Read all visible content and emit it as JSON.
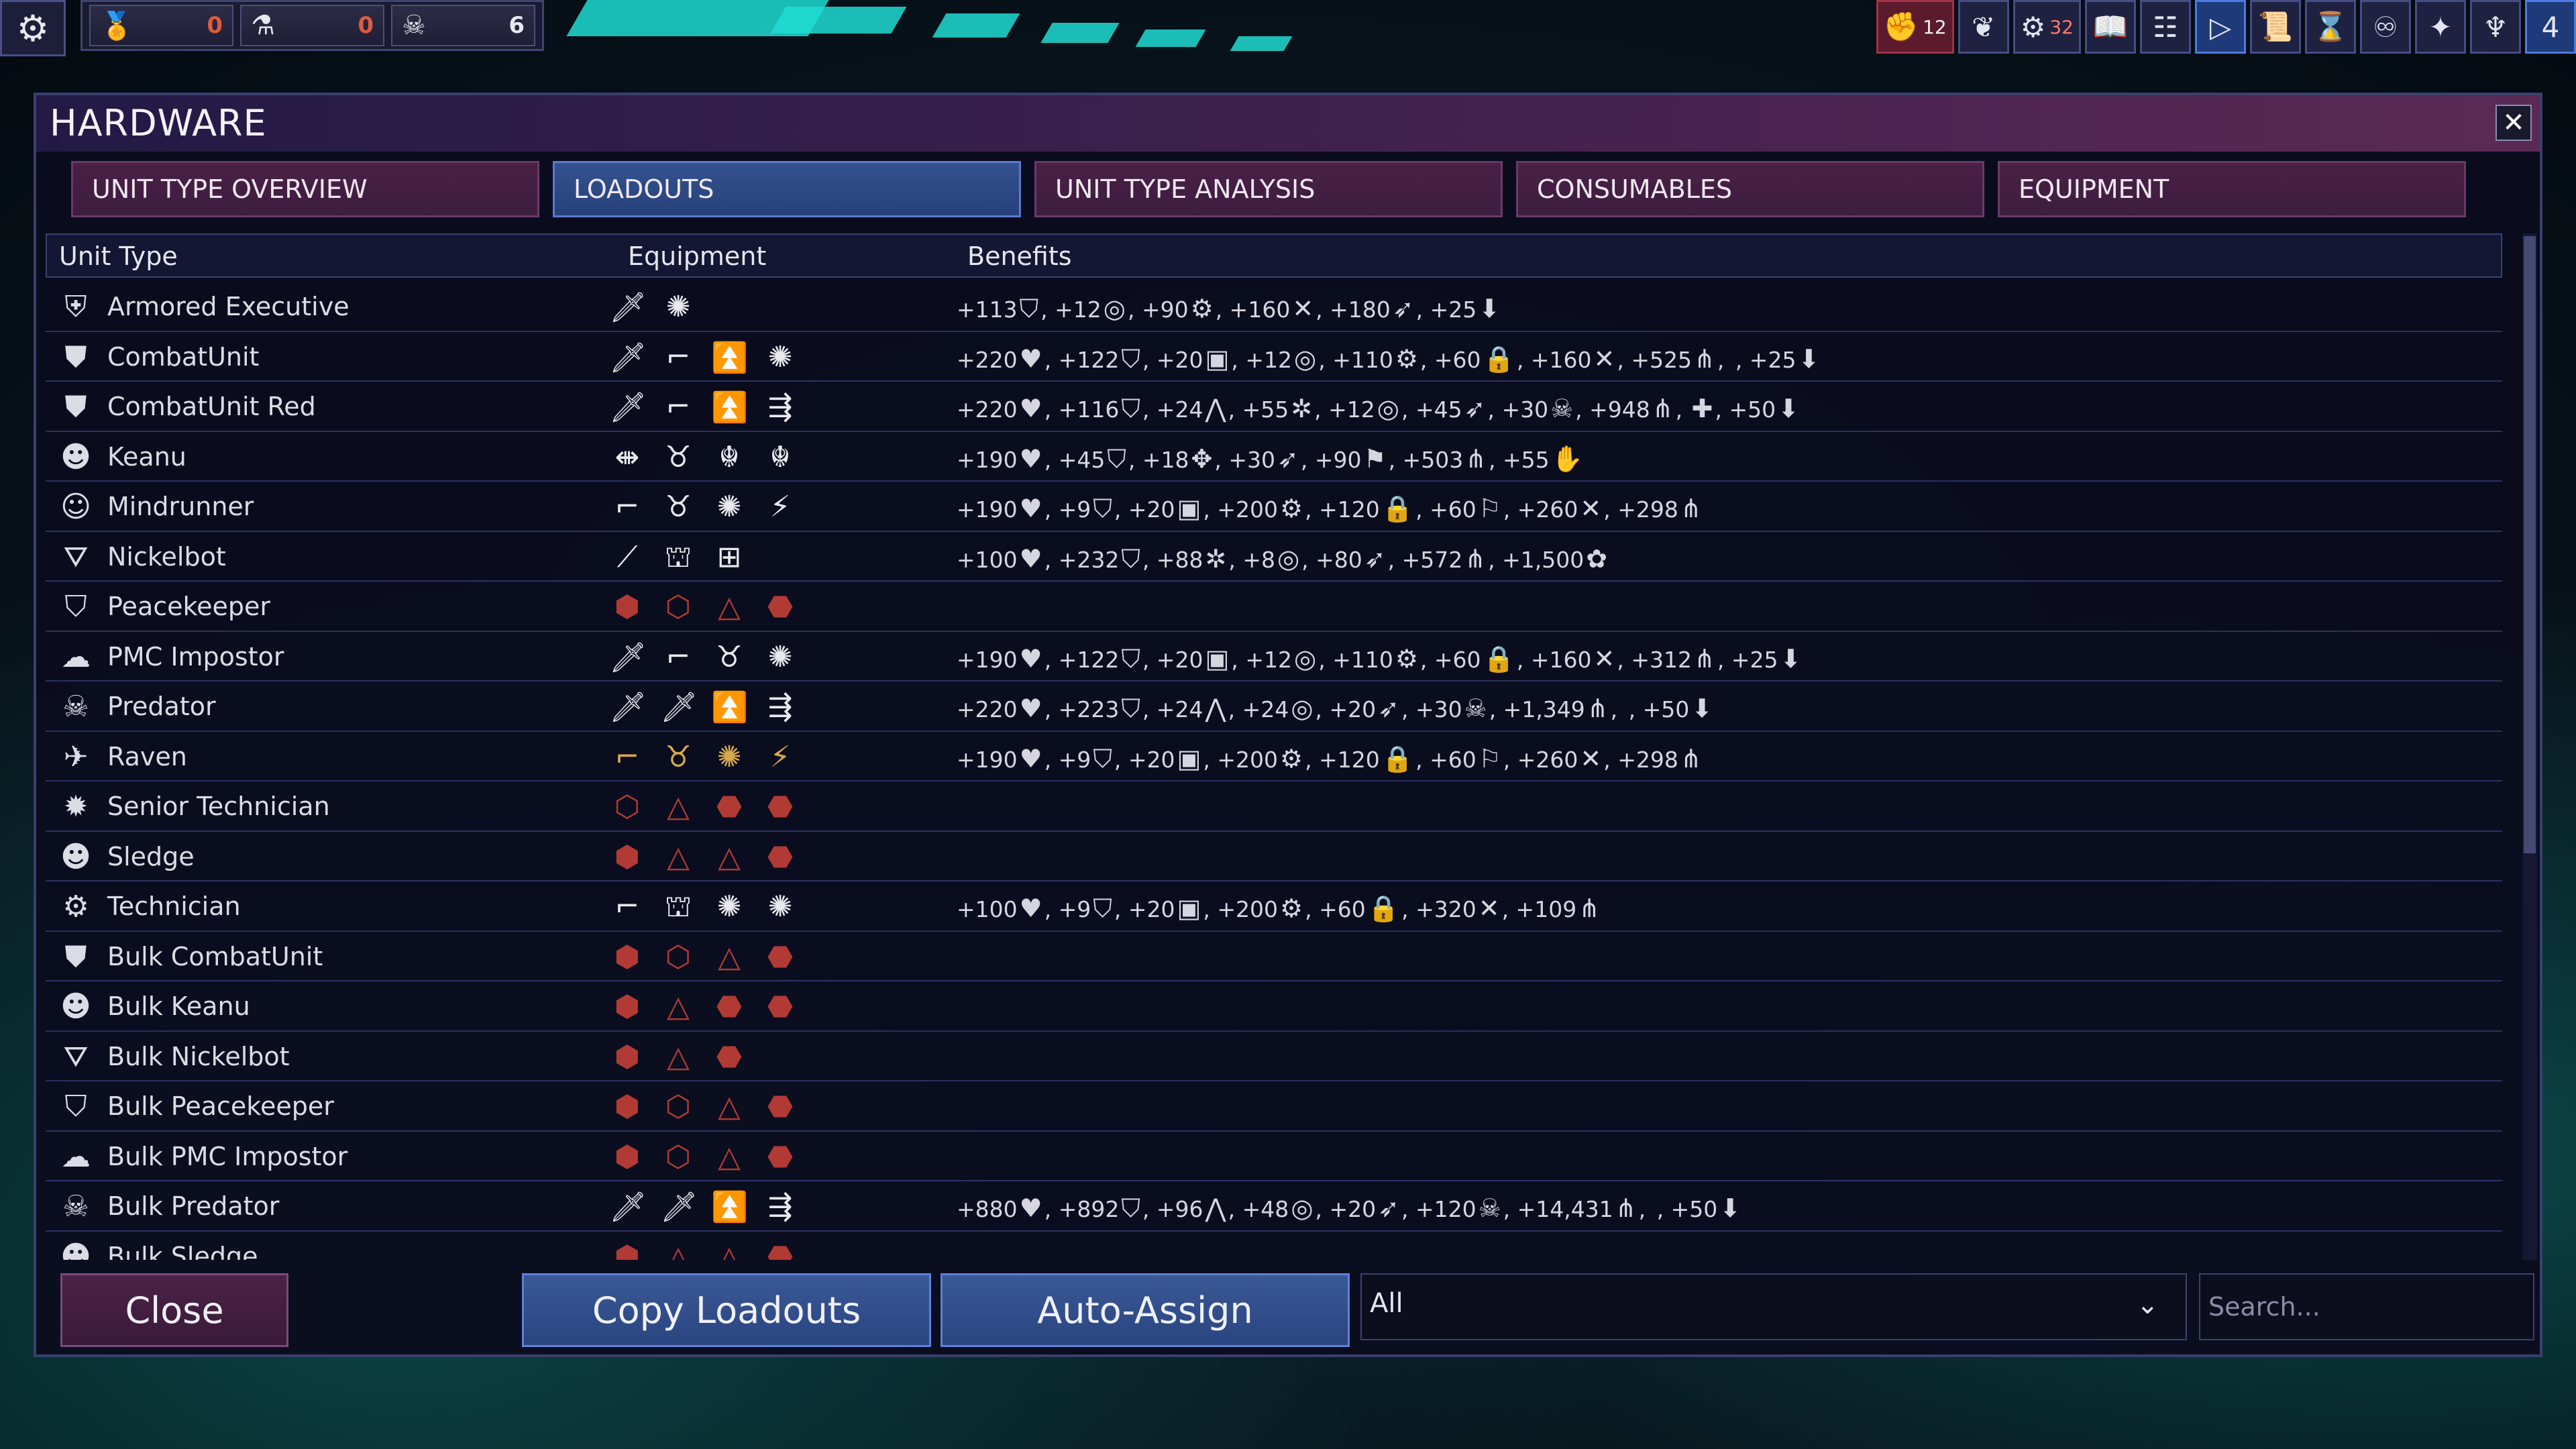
{
  "hud": {
    "resources": [
      {
        "icon": "medal-icon",
        "glyph": "🏅",
        "value": "0"
      },
      {
        "icon": "flask-icon",
        "glyph": "⚗",
        "value": "0"
      },
      {
        "icon": "skull-icon",
        "glyph": "☠",
        "value": "6"
      }
    ],
    "toolbar": [
      {
        "icon": "fist-icon",
        "glyph": "✊",
        "badge": "12",
        "style": "red"
      },
      {
        "icon": "laurel-icon",
        "glyph": "❦"
      },
      {
        "icon": "gear-alert-icon",
        "glyph": "⚙",
        "badge": "32",
        "badge_style": "red"
      },
      {
        "icon": "book-icon",
        "glyph": "📖"
      },
      {
        "icon": "levels-icon",
        "glyph": "☷"
      },
      {
        "icon": "play-icon",
        "glyph": "▷",
        "style": "blue"
      },
      {
        "icon": "scroll-icon",
        "glyph": "📜"
      },
      {
        "icon": "hourglass-icon",
        "glyph": "⌛"
      },
      {
        "icon": "brain-icon",
        "glyph": "♾"
      },
      {
        "icon": "emblem-icon",
        "glyph": "✦"
      },
      {
        "icon": "trident-icon",
        "glyph": "♆"
      },
      {
        "icon": "number-icon",
        "glyph": "4",
        "style": "blue"
      }
    ]
  },
  "window": {
    "title": "HARDWARE",
    "tabs": [
      "UNIT TYPE OVERVIEW",
      "LOADOUTS",
      "UNIT TYPE ANALYSIS",
      "CONSUMABLES",
      "EQUIPMENT"
    ],
    "active_tab": 1,
    "columns": [
      "Unit Type",
      "Equipment",
      "Benefits"
    ]
  },
  "rows": [
    {
      "name": "Armored Executive",
      "icon": "⛨",
      "equip": [
        {
          "g": "🗡"
        },
        {
          "g": "✺"
        }
      ],
      "benefits": [
        [
          "+113",
          "⛉"
        ],
        [
          "+12",
          "◎"
        ],
        [
          "+90",
          "⚙"
        ],
        [
          "+160",
          "✕"
        ],
        [
          "+180",
          "➶"
        ],
        [
          "+25",
          "⬇"
        ]
      ]
    },
    {
      "name": "CombatUnit",
      "icon": "⛊",
      "equip": [
        {
          "g": "🗡"
        },
        {
          "g": "⌐"
        },
        {
          "g": "⏫"
        },
        {
          "g": "✺"
        }
      ],
      "benefits": [
        [
          "+220",
          "♥"
        ],
        [
          "+122",
          "⛉"
        ],
        [
          "+20",
          "▣"
        ],
        [
          "+12",
          "◎"
        ],
        [
          "+110",
          "⚙"
        ],
        [
          "+60",
          "🔒"
        ],
        [
          "+160",
          "✕"
        ],
        [
          "+525",
          "⋔"
        ],
        [
          "",
          ""
        ],
        [
          "+25",
          "⬇"
        ]
      ]
    },
    {
      "name": "CombatUnit Red",
      "icon": "⛊",
      "equip": [
        {
          "g": "🗡"
        },
        {
          "g": "⌐"
        },
        {
          "g": "⏫"
        },
        {
          "g": "⇶"
        }
      ],
      "benefits": [
        [
          "+220",
          "♥"
        ],
        [
          "+116",
          "⛉"
        ],
        [
          "+24",
          "⋀"
        ],
        [
          "+55",
          "✲"
        ],
        [
          "+12",
          "◎"
        ],
        [
          "+45",
          "➶"
        ],
        [
          "+30",
          "☠"
        ],
        [
          "+948",
          "⋔"
        ],
        [
          "",
          "✚"
        ],
        [
          "+50",
          "⬇"
        ]
      ]
    },
    {
      "name": "Keanu",
      "icon": "☻",
      "equip": [
        {
          "g": "⇼"
        },
        {
          "g": "♉"
        },
        {
          "g": "☬"
        },
        {
          "g": "☬"
        }
      ],
      "benefits": [
        [
          "+190",
          "♥"
        ],
        [
          "+45",
          "⛉"
        ],
        [
          "+18",
          "✥"
        ],
        [
          "+30",
          "➶"
        ],
        [
          "+90",
          "⚑"
        ],
        [
          "+503",
          "⋔"
        ],
        [
          "+55",
          "✋"
        ]
      ]
    },
    {
      "name": "Mindrunner",
      "icon": "☺",
      "equip": [
        {
          "g": "⌐"
        },
        {
          "g": "♉"
        },
        {
          "g": "✺"
        },
        {
          "g": "⚡"
        }
      ],
      "benefits": [
        [
          "+190",
          "♥"
        ],
        [
          "+9",
          "⛉"
        ],
        [
          "+20",
          "▣"
        ],
        [
          "+200",
          "⚙"
        ],
        [
          "+120",
          "🔒"
        ],
        [
          "+60",
          "⚐"
        ],
        [
          "+260",
          "✕"
        ],
        [
          "+298",
          "⋔"
        ]
      ]
    },
    {
      "name": "Nickelbot",
      "icon": "⛛",
      "equip": [
        {
          "g": "⟋"
        },
        {
          "g": "⛫"
        },
        {
          "g": "⊞"
        }
      ],
      "benefits": [
        [
          "+100",
          "♥"
        ],
        [
          "+232",
          "⛉"
        ],
        [
          "+88",
          "✲"
        ],
        [
          "+8",
          "◎"
        ],
        [
          "+80",
          "➶"
        ],
        [
          "+572",
          "⋔"
        ],
        [
          "+1,500",
          "✿"
        ]
      ]
    },
    {
      "name": "Peacekeeper",
      "icon": "⛉",
      "equip": [
        {
          "g": "⬢",
          "m": 1
        },
        {
          "g": "⬡",
          "m": 1
        },
        {
          "g": "△",
          "m": 1
        },
        {
          "g": "⬣",
          "m": 1
        }
      ],
      "benefits": []
    },
    {
      "name": "PMC Impostor",
      "icon": "☁",
      "equip": [
        {
          "g": "🗡"
        },
        {
          "g": "⌐"
        },
        {
          "g": "♉"
        },
        {
          "g": "✺"
        }
      ],
      "benefits": [
        [
          "+190",
          "♥"
        ],
        [
          "+122",
          "⛉"
        ],
        [
          "+20",
          "▣"
        ],
        [
          "+12",
          "◎"
        ],
        [
          "+110",
          "⚙"
        ],
        [
          "+60",
          "🔒"
        ],
        [
          "+160",
          "✕"
        ],
        [
          "+312",
          "⋔"
        ],
        [
          "+25",
          "⬇"
        ]
      ]
    },
    {
      "name": "Predator",
      "icon": "☠",
      "equip": [
        {
          "g": "🗡"
        },
        {
          "g": "🗡"
        },
        {
          "g": "⏫"
        },
        {
          "g": "⇶"
        }
      ],
      "benefits": [
        [
          "+220",
          "♥"
        ],
        [
          "+223",
          "⛉"
        ],
        [
          "+24",
          "⋀"
        ],
        [
          "+24",
          "◎"
        ],
        [
          "+20",
          "➶"
        ],
        [
          "+30",
          "☠"
        ],
        [
          "+1,349",
          "⋔"
        ],
        [
          "",
          ""
        ],
        [
          "+50",
          "⬇"
        ]
      ]
    },
    {
      "name": "Raven",
      "icon": "✈",
      "equip": [
        {
          "g": "⌐",
          "gold": 1
        },
        {
          "g": "♉",
          "gold": 1
        },
        {
          "g": "✺",
          "gold": 1
        },
        {
          "g": "⚡",
          "gold": 1
        }
      ],
      "benefits": [
        [
          "+190",
          "♥"
        ],
        [
          "+9",
          "⛉"
        ],
        [
          "+20",
          "▣"
        ],
        [
          "+200",
          "⚙"
        ],
        [
          "+120",
          "🔒"
        ],
        [
          "+60",
          "⚐"
        ],
        [
          "+260",
          "✕"
        ],
        [
          "+298",
          "⋔"
        ]
      ]
    },
    {
      "name": "Senior Technician",
      "icon": "✹",
      "equip": [
        {
          "g": "⬡",
          "m": 1
        },
        {
          "g": "△",
          "m": 1
        },
        {
          "g": "⬣",
          "m": 1
        },
        {
          "g": "⬣",
          "m": 1
        }
      ],
      "benefits": []
    },
    {
      "name": "Sledge",
      "icon": "☻",
      "equip": [
        {
          "g": "⬢",
          "m": 1
        },
        {
          "g": "△",
          "m": 1
        },
        {
          "g": "△",
          "m": 1
        },
        {
          "g": "⬣",
          "m": 1
        }
      ],
      "benefits": []
    },
    {
      "name": "Technician",
      "icon": "⚙",
      "equip": [
        {
          "g": "⌐"
        },
        {
          "g": "⛫"
        },
        {
          "g": "✺"
        },
        {
          "g": "✺"
        }
      ],
      "benefits": [
        [
          "+100",
          "♥"
        ],
        [
          "+9",
          "⛉"
        ],
        [
          "+20",
          "▣"
        ],
        [
          "+200",
          "⚙"
        ],
        [
          "+60",
          "🔒"
        ],
        [
          "+320",
          "✕"
        ],
        [
          "+109",
          "⋔"
        ]
      ]
    },
    {
      "name": "Bulk CombatUnit",
      "icon": "⛊",
      "equip": [
        {
          "g": "⬢",
          "m": 1
        },
        {
          "g": "⬡",
          "m": 1
        },
        {
          "g": "△",
          "m": 1
        },
        {
          "g": "⬣",
          "m": 1
        }
      ],
      "benefits": []
    },
    {
      "name": "Bulk Keanu",
      "icon": "☻",
      "equip": [
        {
          "g": "⬢",
          "m": 1
        },
        {
          "g": "△",
          "m": 1
        },
        {
          "g": "⬣",
          "m": 1
        },
        {
          "g": "⬣",
          "m": 1
        }
      ],
      "benefits": []
    },
    {
      "name": "Bulk Nickelbot",
      "icon": "⛛",
      "equip": [
        {
          "g": "⬢",
          "m": 1
        },
        {
          "g": "△",
          "m": 1
        },
        {
          "g": "⬣",
          "m": 1
        }
      ],
      "benefits": []
    },
    {
      "name": "Bulk Peacekeeper",
      "icon": "⛉",
      "equip": [
        {
          "g": "⬢",
          "m": 1
        },
        {
          "g": "⬡",
          "m": 1
        },
        {
          "g": "△",
          "m": 1
        },
        {
          "g": "⬣",
          "m": 1
        }
      ],
      "benefits": []
    },
    {
      "name": "Bulk PMC Impostor",
      "icon": "☁",
      "equip": [
        {
          "g": "⬢",
          "m": 1
        },
        {
          "g": "⬡",
          "m": 1
        },
        {
          "g": "△",
          "m": 1
        },
        {
          "g": "⬣",
          "m": 1
        }
      ],
      "benefits": []
    },
    {
      "name": "Bulk Predator",
      "icon": "☠",
      "equip": [
        {
          "g": "🗡"
        },
        {
          "g": "🗡"
        },
        {
          "g": "⏫"
        },
        {
          "g": "⇶"
        }
      ],
      "benefits": [
        [
          "+880",
          "♥"
        ],
        [
          "+892",
          "⛉"
        ],
        [
          "+96",
          "⋀"
        ],
        [
          "+48",
          "◎"
        ],
        [
          "+20",
          "➶"
        ],
        [
          "+120",
          "☠"
        ],
        [
          "+14,431",
          "⋔"
        ],
        [
          "",
          ""
        ],
        [
          "+50",
          "⬇"
        ]
      ]
    },
    {
      "name": "Bulk Sledge",
      "icon": "☻",
      "equip": [
        {
          "g": "⬢",
          "m": 1
        },
        {
          "g": "△",
          "m": 1
        },
        {
          "g": "△",
          "m": 1
        },
        {
          "g": "⬣",
          "m": 1
        }
      ],
      "benefits": []
    }
  ],
  "bottom": {
    "close_label": "Close",
    "copy_label": "Copy Loadouts",
    "auto_label": "Auto-Assign",
    "filter_value": "All",
    "search_placeholder": "Search..."
  },
  "colors": {
    "accent_blue": "#2a4580",
    "accent_purple": "#3a1a3a",
    "missing_red": "#b23a34"
  }
}
